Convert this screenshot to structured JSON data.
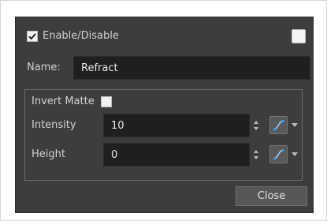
{
  "enable": {
    "label": "Enable/Disable",
    "checked": true
  },
  "color_swatch": {
    "color": "#f4f4f4"
  },
  "name": {
    "label": "Name:",
    "value": "Refract"
  },
  "invert_matte": {
    "label": "Invert Matte",
    "checked": false
  },
  "intensity": {
    "label": "Intensity",
    "value": "10"
  },
  "height": {
    "label": "Height",
    "value": "0"
  },
  "close_label": "Close",
  "icons": {
    "spin": "spinner-arrows-icon",
    "function": "function-curve-icon",
    "dropdown": "chevron-down-icon"
  }
}
